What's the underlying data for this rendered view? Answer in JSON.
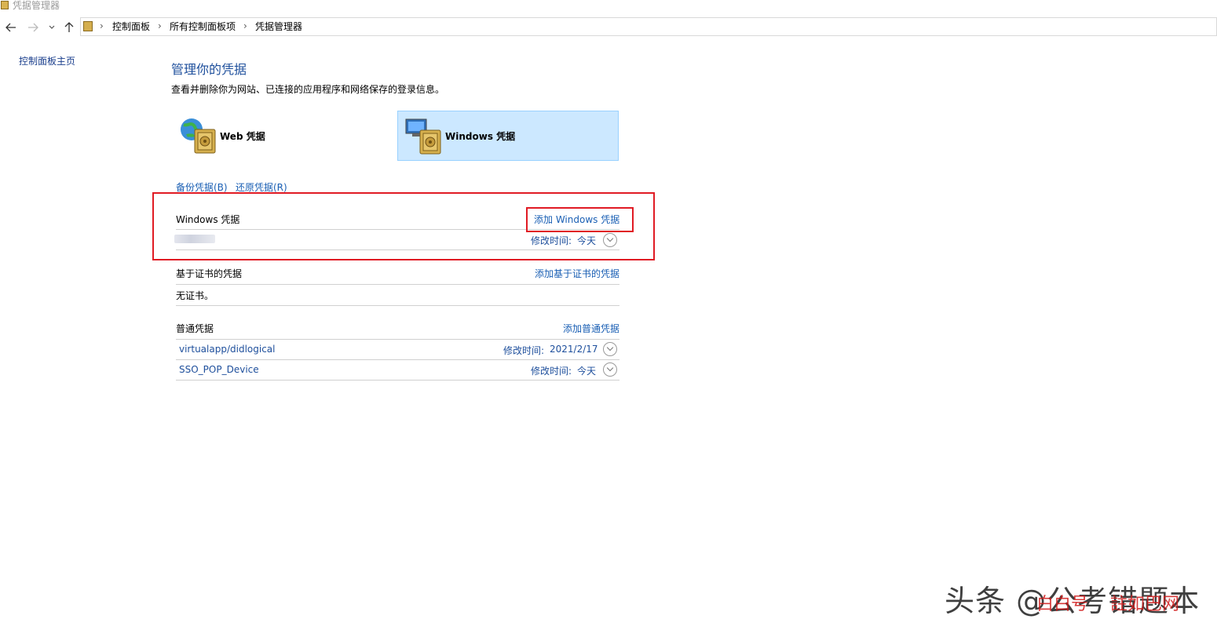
{
  "window": {
    "title": "凭据管理器"
  },
  "address_bar": {
    "crumbs": [
      "控制面板",
      "所有控制面板项",
      "凭据管理器"
    ],
    "separator": "›"
  },
  "left_nav": {
    "home_label": "控制面板主页"
  },
  "main": {
    "title": "管理你的凭据",
    "description": "查看并删除你为网站、已连接的应用程序和网络保存的登录信息。",
    "tiles": {
      "web_label": "Web 凭据",
      "windows_label": "Windows 凭据",
      "selected": "Windows 凭据"
    },
    "backup_label": "备份凭据(B)",
    "restore_label": "还原凭据(R)",
    "windows_section": {
      "title": "Windows 凭据",
      "add_label": "添加 Windows 凭据",
      "items": [
        {
          "name": "",
          "modified_label": "修改时间:",
          "modified_value": "今天"
        }
      ]
    },
    "cert_section": {
      "title": "基于证书的凭据",
      "add_label": "添加基于证书的凭据",
      "empty_text": "无证书。"
    },
    "generic_section": {
      "title": "普通凭据",
      "add_label": "添加普通凭据",
      "items": [
        {
          "name": "virtualapp/didlogical",
          "modified_label": "修改时间:",
          "modified_value": "2021/2/17"
        },
        {
          "name": "SSO_POP_Device",
          "modified_label": "修改时间:",
          "modified_value": "今天"
        }
      ]
    }
  },
  "watermark": {
    "text": "头条 @公考错题本",
    "red_a": "白白号",
    "red_b": "註如巴网"
  },
  "colors": {
    "link": "#1a5fb4",
    "title": "#1e4f9c",
    "selection": "#cce8ff",
    "highlight_box": "#e01b24"
  },
  "icons": [
    "back-arrow-icon",
    "forward-arrow-icon",
    "recent-chevron-icon",
    "up-arrow-icon",
    "credential-manager-icon",
    "globe-vault-icon",
    "computer-vault-icon",
    "expand-chevron-icon"
  ]
}
